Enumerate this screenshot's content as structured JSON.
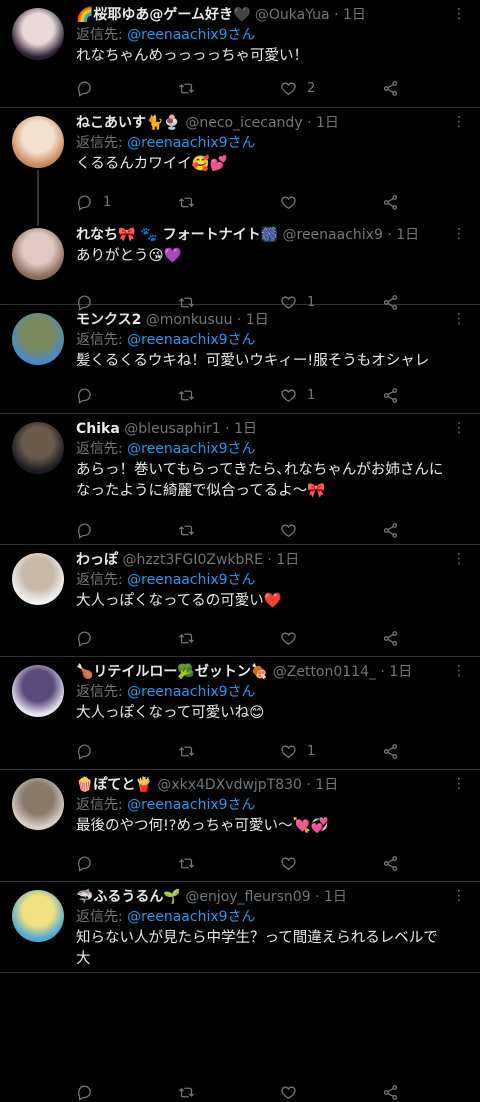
{
  "tweets": [
    {
      "name": "🌈桜耶ゆあ@ゲーム好き🖤",
      "handle": "@OukaYua",
      "time": "1日",
      "reply_label": "返信先: ",
      "reply_to": "@reenaachix9さん",
      "text": "れなちゃんめっっっっちゃ可愛い！",
      "reply_count": "",
      "retweet_count": "",
      "like_count": "2",
      "avatar_colors": [
        "#2a2030",
        "#e8d8d8"
      ]
    },
    {
      "name": "ねこあいす🐈🍨",
      "handle": "@neco_icecandy",
      "time": "1日",
      "reply_label": "返信先: ",
      "reply_to": "@reenaachix9さん",
      "text": "くるるんカワイイ🥰💕",
      "reply_count": "1",
      "retweet_count": "",
      "like_count": "",
      "avatar_colors": [
        "#c98a5a",
        "#f4e2d0"
      ]
    },
    {
      "name": "れなち🎀 🐾 フォートナイト🎆",
      "handle": "@reenaachix9",
      "time": "1日",
      "reply_label": "",
      "reply_to": "",
      "text": "ありがとう😘💜",
      "reply_count": "",
      "retweet_count": "",
      "like_count": "1",
      "avatar_colors": [
        "#8a6a5a",
        "#e0c8c0"
      ]
    },
    {
      "name": "モンクス2",
      "handle": "@monkusuu",
      "time": "1日",
      "reply_label": "返信先: ",
      "reply_to": "@reenaachix9さん",
      "text": "髪くるくるウキね！可愛いウキィー!服そうもオシャレ",
      "reply_count": "",
      "retweet_count": "",
      "like_count": "1",
      "avatar_colors": [
        "#4a8acb",
        "#7a8a5a"
      ]
    },
    {
      "name": "Chika",
      "handle": "@bleusaphir1",
      "time": "1日",
      "reply_label": "返信先: ",
      "reply_to": "@reenaachix9さん",
      "text": "あらっ！巻いてもらってきたら､れなちゃんがお姉さんになったように綺麗で似合ってるよ〜🎀",
      "reply_count": "",
      "retweet_count": "",
      "like_count": "",
      "avatar_colors": [
        "#1a1a22",
        "#6a5a4a"
      ]
    },
    {
      "name": "わっぽ",
      "handle": "@hzzt3FGI0ZwkbRE",
      "time": "1日",
      "reply_label": "返信先: ",
      "reply_to": "@reenaachix9さん",
      "text": "大人っぽくなってるの可愛い❤️",
      "reply_count": "",
      "retweet_count": "",
      "like_count": "",
      "avatar_colors": [
        "#f2f2f2",
        "#c8b8a8"
      ]
    },
    {
      "name": "🍗リテイルロー🥦ゼットン🍖",
      "handle": "@Zetton0114_",
      "time": "1日",
      "reply_label": "返信先: ",
      "reply_to": "@reenaachix9さん",
      "text": "大人っぽくなって可愛いね😊",
      "reply_count": "",
      "retweet_count": "",
      "like_count": "1",
      "avatar_colors": [
        "#e8e4f0",
        "#5a4a7a"
      ]
    },
    {
      "name": "🍿ぽてと🍟",
      "handle": "@xkx4DXvdwjpT830",
      "time": "1日",
      "reply_label": "返信先: ",
      "reply_to": "@reenaachix9さん",
      "text": "最後のやつ何!?めっちゃ可愛い〜💘💞",
      "reply_count": "",
      "retweet_count": "",
      "like_count": "",
      "avatar_colors": [
        "#d8d0c8",
        "#8a7a6a"
      ]
    },
    {
      "name": "🦈ふるうるん🌱",
      "handle": "@enjoy_fleursn09",
      "time": "1日",
      "reply_label": "返信先: ",
      "reply_to": "@reenaachix9さん",
      "text": "知らない人が見たら中学生？って間違えられるレベルで大",
      "reply_count": "",
      "retweet_count": "",
      "like_count": "",
      "avatar_colors": [
        "#4aa8d8",
        "#f0e080"
      ]
    }
  ]
}
